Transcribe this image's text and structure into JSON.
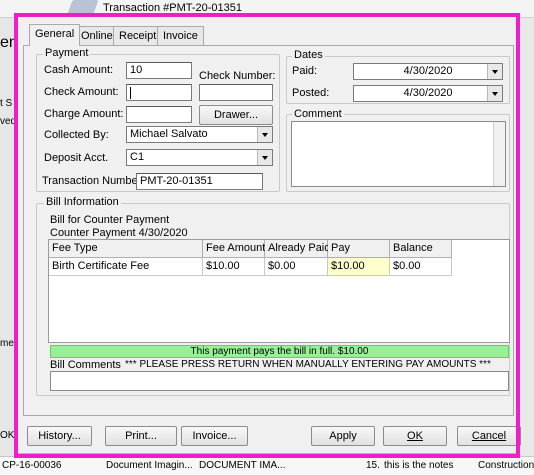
{
  "app_background": {
    "title": "Transaction #PMT-20-01351",
    "left_fragments": [
      "en",
      "t S",
      "ved",
      "me",
      "OK"
    ],
    "status_bar": [
      "CP-16-00036",
      "Document Imagin...",
      "DOCUMENT IMA...",
      "15.",
      "this is the notes",
      "Construction"
    ]
  },
  "dialog": {
    "tabs": [
      {
        "label": "General"
      },
      {
        "label": "Online"
      },
      {
        "label": "Receipt"
      },
      {
        "label": "Invoice"
      }
    ],
    "payment": {
      "group_label": "Payment",
      "cash_amount_label": "Cash Amount:",
      "cash_amount_value": "10",
      "check_number_label": "Check Number:",
      "check_number_value": "",
      "check_amount_label": "Check Amount:",
      "check_amount_value": "",
      "charge_amount_label": "Charge Amount:",
      "charge_amount_value": "",
      "drawer_button": "Drawer...",
      "collected_by_label": "Collected By:",
      "collected_by_value": "Michael Salvato",
      "deposit_acct_label": "Deposit Acct.",
      "deposit_acct_value": "C1",
      "transaction_number_label": "Transaction Number:",
      "transaction_number_value": "PMT-20-01351"
    },
    "dates": {
      "group_label": "Dates",
      "paid_label": "Paid:",
      "paid_value": "4/30/2020",
      "posted_label": "Posted:",
      "posted_value": "4/30/2020"
    },
    "comment": {
      "group_label": "Comment",
      "value": ""
    },
    "bill_information": {
      "group_label": "Bill Information",
      "line1": "Bill for Counter Payment",
      "line2": "Counter Payment 4/30/2020",
      "columns": [
        "Fee Type",
        "Fee Amount",
        "Already Paid",
        "Pay",
        "Balance"
      ],
      "rows": [
        {
          "fee_type": "Birth Certificate Fee",
          "fee_amount": "$10.00",
          "already_paid": "$0.00",
          "pay": "$10.00",
          "balance": "$0.00"
        }
      ],
      "full_payment_message": "This payment pays the bill in full. $10.00",
      "bill_comments_label": "Bill Comments",
      "bill_comments_notice": "*** PLEASE PRESS RETURN WHEN MANUALLY ENTERING PAY AMOUNTS ***",
      "bill_comments_value": ""
    },
    "buttons": {
      "history": "History...",
      "print": "Print...",
      "invoice": "Invoice...",
      "apply": "Apply",
      "ok": "OK",
      "cancel": "Cancel"
    },
    "colors": {
      "highlight_border": "#f01ec8",
      "full_payment_bg": "#99ee99",
      "pay_cell_bg": "#ffffcc"
    }
  }
}
